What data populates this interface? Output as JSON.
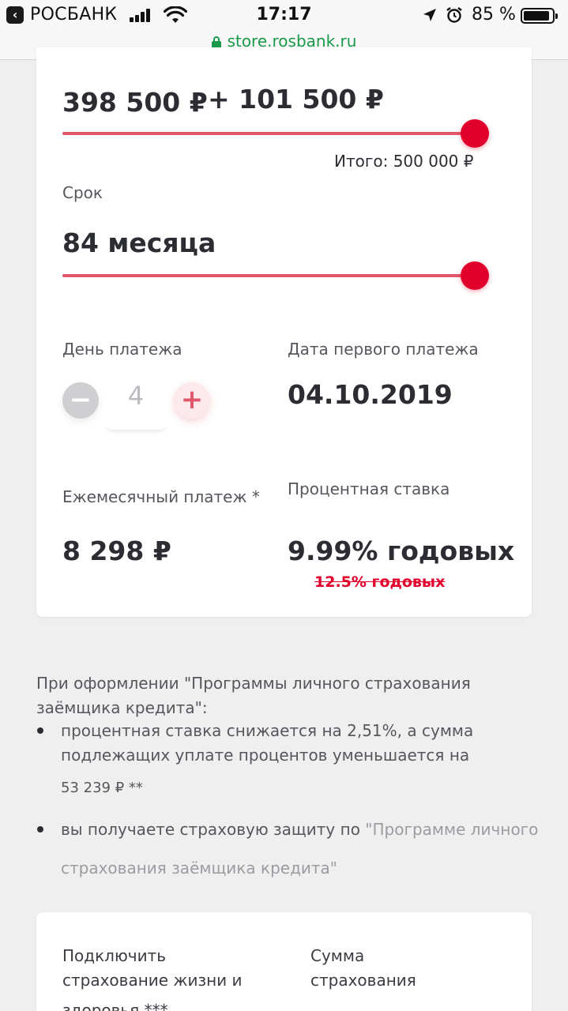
{
  "status_bar": {
    "carrier": "РОСБАНК",
    "time": "17:17",
    "battery": "85 %",
    "url": "store.rosbank.ru"
  },
  "loan": {
    "amount_left": "398 500 ₽",
    "amount_plus": "+ 101 500 ₽",
    "amount_slider_fraction": 1.0,
    "total_label": "Итого: 500 000 ₽",
    "term_label": "Срок",
    "term_value": "84  месяца",
    "term_slider_fraction": 1.0,
    "pay_day_label": "День платежа",
    "pay_day_value": "4",
    "first_payment_label": "Дата первого платежа",
    "first_payment_value": "04.10.2019",
    "monthly_label": "Ежемесячный платеж *",
    "monthly_value": "8 298 ₽",
    "rate_label": "Процентная ставка",
    "rate_value": "9.99% годовых",
    "rate_old": "12.5% годовых"
  },
  "insurance_info": {
    "intro": "При оформлении \"Программы личного страхования заёмщика кредита\":",
    "bullet1_line1": "процентная ставка снижается на 2,51%, а сумма",
    "bullet1_line2": "подлежащих уплате процентов уменьшается на",
    "bullet1_line3": "53 239 ₽ **",
    "bullet2_prefix": "вы получаете страховую защиту по",
    "bullet2_link_line1": "\"Программе личного",
    "bullet2_link_line2": "страхования заёмщика кредита\""
  },
  "insurance_card": {
    "connect_label_line1": "Подключить",
    "connect_label_line2": "страхование жизни и",
    "connect_label_line3": "здоровья ***",
    "sum_label_line1": "Сумма",
    "sum_label_line2": "страхования"
  },
  "colors": {
    "accent": "#e1002b",
    "slider": "#e0576b",
    "url_green": "#1a9a4a"
  }
}
